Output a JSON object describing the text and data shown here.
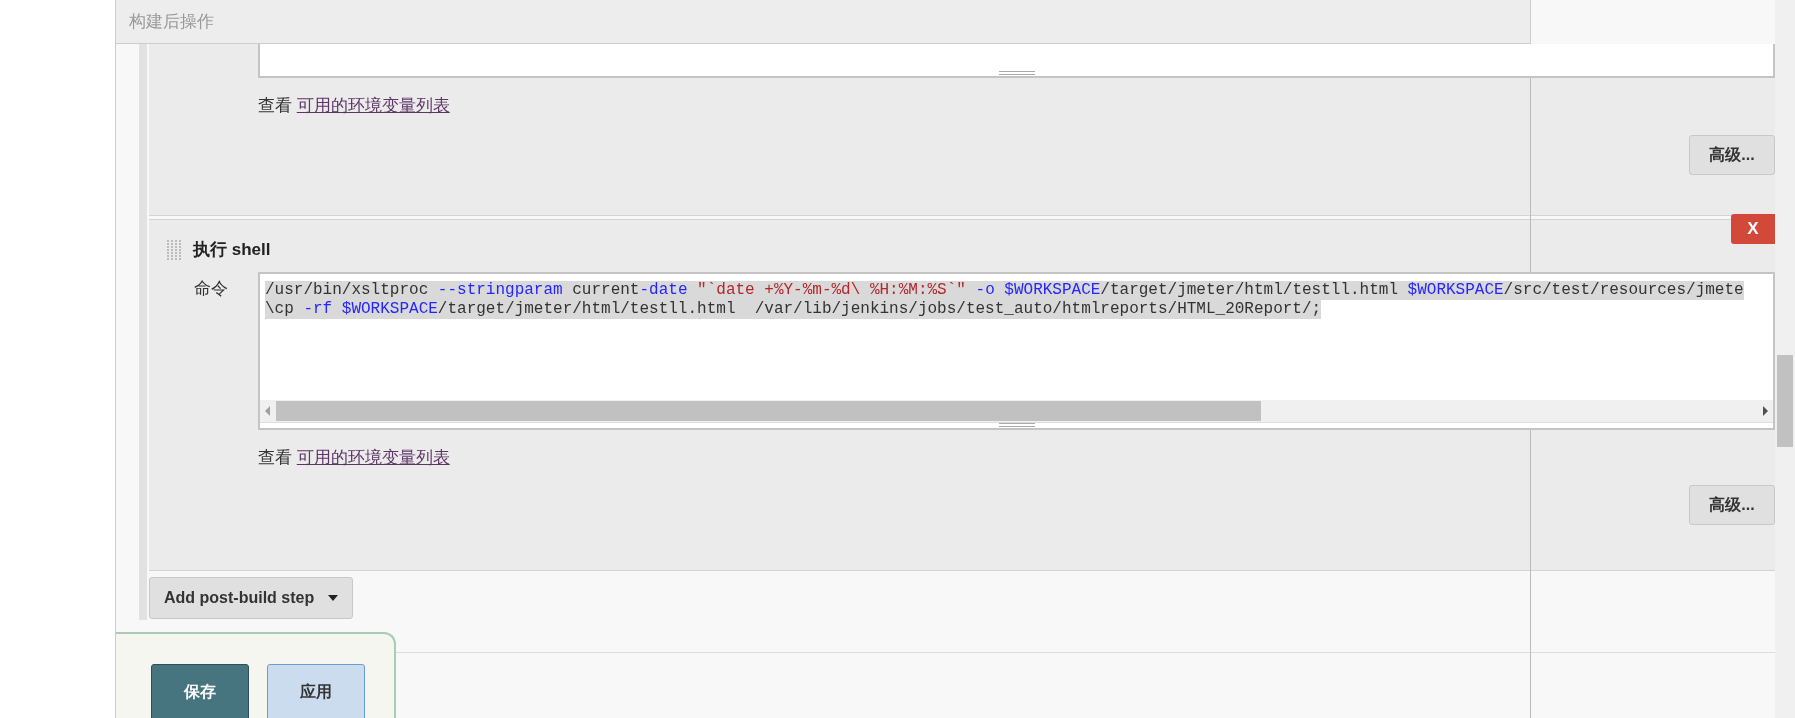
{
  "section_header": {
    "title": "构建后操作"
  },
  "steps": [
    {
      "kind": "partial",
      "env_note": {
        "prefix": "查看",
        "link": "可用的环境变量列表"
      },
      "advanced_button": "高级..."
    },
    {
      "kind": "shell",
      "title": "执行 shell",
      "delete_button": "X",
      "field_label": "命令",
      "command": {
        "selected": true,
        "lines": [
          [
            {
              "text": "/usr/bin/xsltproc ",
              "kind": "plain"
            },
            {
              "text": "--stringparam",
              "kind": "keyword"
            },
            {
              "text": " current",
              "kind": "plain"
            },
            {
              "text": "-date ",
              "kind": "keyword"
            },
            {
              "text": "\"`date +%Y-%m-%d\\ %H:%M:%S`\"",
              "kind": "string"
            },
            {
              "text": " -o ",
              "kind": "keyword"
            },
            {
              "text": "$WORKSPACE",
              "kind": "keyword"
            },
            {
              "text": "/target/jmeter/html/testll.html ",
              "kind": "plain"
            },
            {
              "text": "$WORKSPACE",
              "kind": "keyword"
            },
            {
              "text": "/src/test/resources/jmete",
              "kind": "plain"
            }
          ],
          [
            {
              "text": "\\cp ",
              "kind": "plain"
            },
            {
              "text": "-rf ",
              "kind": "keyword"
            },
            {
              "text": "$WORKSPACE",
              "kind": "keyword"
            },
            {
              "text": "/target/jmeter/html/testll.html  /var/lib/jenkins/jobs/test_auto/htmlreports/HTML_20Report/;",
              "kind": "plain"
            }
          ]
        ]
      },
      "env_note": {
        "prefix": "查看",
        "link": "可用的环境变量列表"
      },
      "advanced_button": "高级..."
    }
  ],
  "add_step_button": "Add post-build step",
  "footer_buttons": [
    {
      "label": "保存",
      "kind": "primary"
    },
    {
      "label": "应用",
      "kind": "secondary"
    }
  ]
}
